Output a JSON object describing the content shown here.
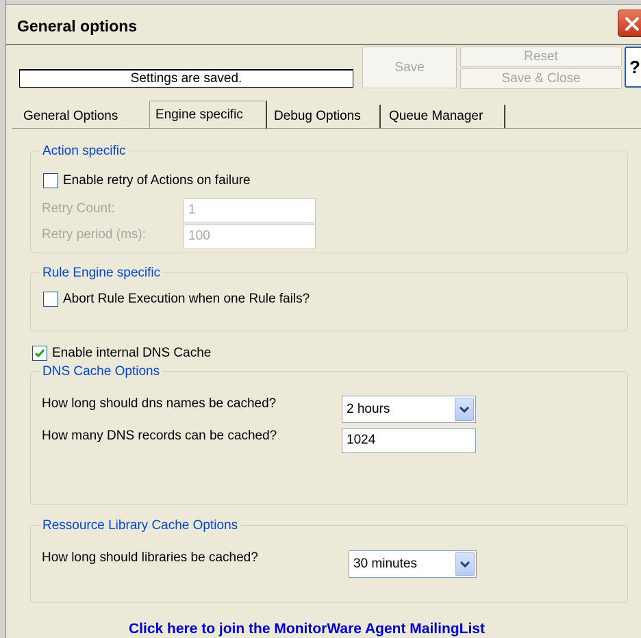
{
  "window": {
    "title": "General options"
  },
  "toolbar": {
    "status_text": "Settings are saved.",
    "save_label": "Save",
    "reset_label": "Reset",
    "save_close_label": "Save & Close",
    "help_label": "?"
  },
  "tabs": [
    {
      "label": "General Options"
    },
    {
      "label": "Engine specific"
    },
    {
      "label": "Debug Options"
    },
    {
      "label": "Queue Manager"
    }
  ],
  "action_specific": {
    "legend": "Action specific",
    "enable_retry_label": "Enable retry of Actions on failure",
    "enable_retry_checked": false,
    "retry_count_label": "Retry Count:",
    "retry_count_value": "1",
    "retry_period_label": "Retry period (ms):",
    "retry_period_value": "100"
  },
  "rule_engine": {
    "legend": "Rule Engine specific",
    "abort_label": "Abort Rule Execution when one Rule fails?",
    "abort_checked": false
  },
  "dns": {
    "enable_label": "Enable internal DNS Cache",
    "enable_checked": true,
    "legend": "DNS Cache Options",
    "cache_time_label": "How long should dns names be cached?",
    "cache_time_value": "2 hours",
    "records_label": "How many DNS records can be cached?",
    "records_value": "1024"
  },
  "resource_library": {
    "legend": "Ressource Library Cache Options",
    "cache_time_label": "How long should libraries be cached?",
    "cache_time_value": "30 minutes"
  },
  "footer": {
    "link_text": "Click here to join the MonitorWare Agent MailingList"
  },
  "colors": {
    "legend_blue": "#0046d5",
    "link_blue": "#0000cc",
    "close_red": "#c1381c",
    "check_green": "#21a121"
  }
}
